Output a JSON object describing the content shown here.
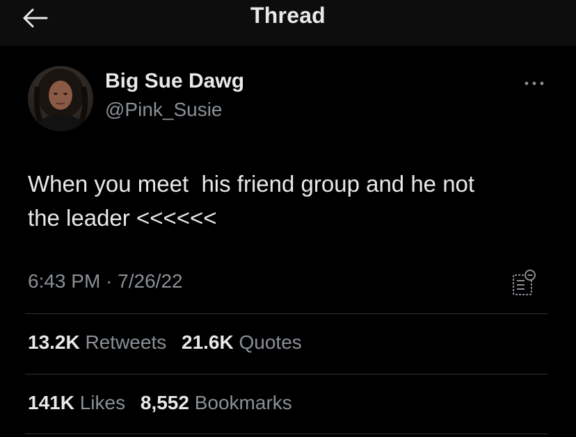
{
  "header": {
    "title": "Thread",
    "back_icon": "arrow-left-icon"
  },
  "tweet": {
    "author": {
      "display_name": "Big Sue Dawg",
      "handle": "@Pink_Susie"
    },
    "text_lines": [
      "When you meet  his friend group and he not",
      "the leader <<<<<<"
    ],
    "time": "6:43 PM",
    "separator": "·",
    "date": "7/26/22",
    "more_icon": "more-horizontal-icon",
    "analytics_icon": "analytics-icon"
  },
  "stats": {
    "retweets": {
      "value": "13.2K",
      "label": "Retweets"
    },
    "quotes": {
      "value": "21.6K",
      "label": "Quotes"
    },
    "likes": {
      "value": "141K",
      "label": "Likes"
    },
    "bookmarks": {
      "value": "8,552",
      "label": "Bookmarks"
    }
  },
  "colors": {
    "background": "#000000",
    "header_bg": "#0d0d0d",
    "primary_text": "#e7e9ea",
    "secondary_text": "#8b9096",
    "divider": "#2f3336"
  }
}
